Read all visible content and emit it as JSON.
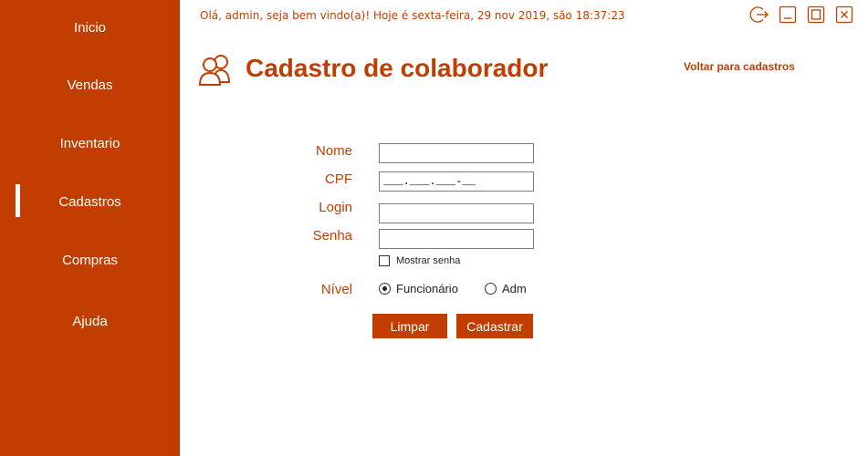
{
  "sidebar": {
    "items": [
      {
        "label": "Inicio"
      },
      {
        "label": "Vendas"
      },
      {
        "label": "Inventario"
      },
      {
        "label": "Cadastros",
        "active": true
      },
      {
        "label": "Compras"
      },
      {
        "label": "Ajuda"
      }
    ]
  },
  "header": {
    "greeting": "Olá, admin, seja bem vindo(a)! Hoje é sexta-feira, 29 nov 2019, são 18:37:23"
  },
  "window_controls": {
    "icons": [
      "logout-icon",
      "minimize-icon",
      "maximize-icon",
      "close-icon"
    ]
  },
  "page": {
    "title": "Cadastro de colaborador",
    "title_icon": "users-icon",
    "back_link": "Voltar para cadastros"
  },
  "form": {
    "nome_label": "Nome",
    "nome_value": "",
    "cpf_label": "CPF",
    "cpf_mask": "___.___.___-__",
    "login_label": "Login",
    "login_value": "",
    "senha_label": "Senha",
    "senha_value": "",
    "show_password_label": "Mostrar senha",
    "show_password_checked": false,
    "nivel_label": "Nível",
    "nivel_options": [
      {
        "label": "Funcionário",
        "selected": true
      },
      {
        "label": "Adm",
        "selected": false
      }
    ],
    "clear_button": "Limpar",
    "submit_button": "Cadastrar"
  },
  "colors": {
    "accent": "#c13e00",
    "background": "#ffffff"
  }
}
